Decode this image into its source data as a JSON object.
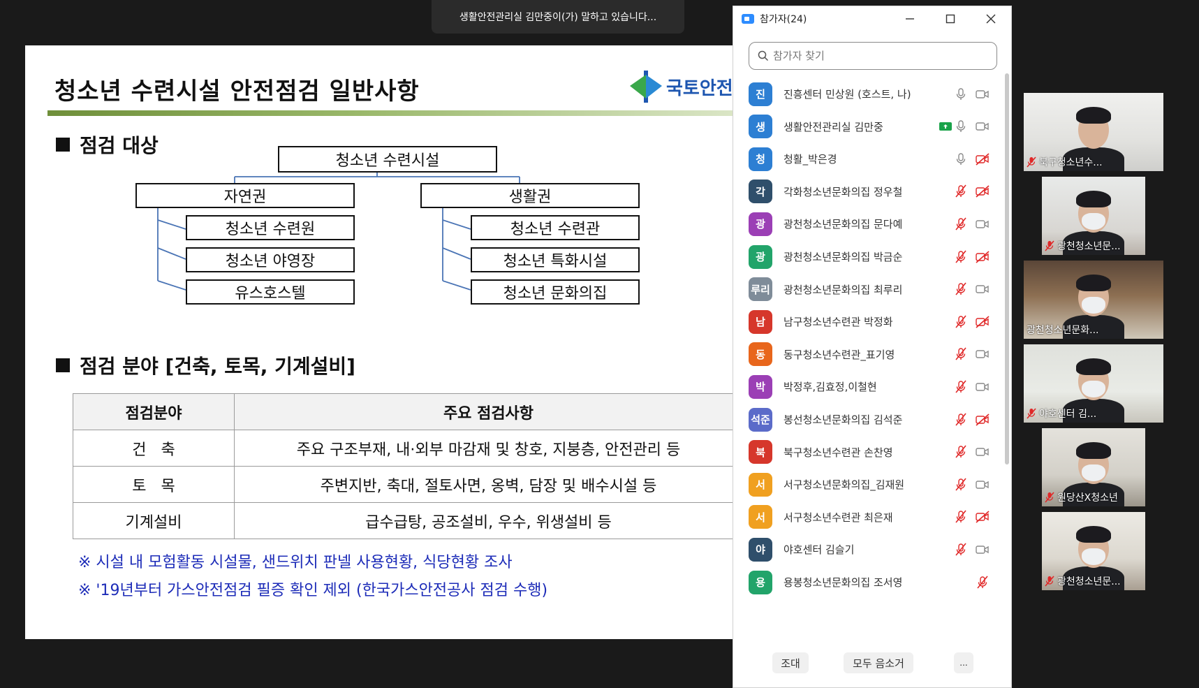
{
  "speaker_banner": "생활안전관리실 김만중이(가) 말하고 있습니다...",
  "slide": {
    "title": "청소년 수련시설 안전점검 일반사항",
    "logo_text": "국토안전",
    "section1": "점검 대상",
    "tree": {
      "root": "청소년 수련시설",
      "branches": [
        {
          "label": "자연권",
          "children": [
            "청소년 수련원",
            "청소년 야영장",
            "유스호스텔"
          ]
        },
        {
          "label": "생활권",
          "children": [
            "청소년 수련관",
            "청소년 특화시설",
            "청소년 문화의집"
          ]
        }
      ]
    },
    "section2": "점검 분야 [건축, 토목, 기계설비]",
    "table": {
      "headers": [
        "점검분야",
        "주요 점검사항"
      ],
      "rows": [
        [
          "건   축",
          "주요 구조부재, 내·외부 마감재 및 창호, 지붕층, 안전관리 등"
        ],
        [
          "토   목",
          "주변지반, 축대, 절토사면, 옹벽, 담장 및 배수시설 등"
        ],
        [
          "기계설비",
          "급수급탕, 공조설비, 우수, 위생설비 등"
        ]
      ]
    },
    "notes": [
      "※ 시설 내 모험활동 시설물, 샌드위치 판넬 사용현황, 식당현황 조사",
      "※ '19년부터 가스안전점검 필증 확인 제외 (한국가스안전공사 점검 수행)"
    ]
  },
  "panel": {
    "title": "참가자(24)",
    "search_placeholder": "참가자 찾기",
    "participants": [
      {
        "avatar": "진",
        "name": "진흥센터 민상원 (호스트, 나)",
        "color": "#2d7fd3",
        "mic": "on",
        "cam": "on",
        "share": false
      },
      {
        "avatar": "생",
        "name": "생활안전관리실 김만중",
        "color": "#2d7fd3",
        "mic": "on",
        "cam": "on",
        "share": true
      },
      {
        "avatar": "청",
        "name": "청활_박은경",
        "color": "#2d7fd3",
        "mic": "on",
        "cam": "off",
        "share": false
      },
      {
        "avatar": "각",
        "name": "각화청소년문화의집 정우철",
        "color": "#2f4f6b",
        "mic": "off",
        "cam": "off",
        "share": false
      },
      {
        "avatar": "광",
        "name": "광천청소년문화의집 문다예",
        "color": "#9b3fb5",
        "mic": "off",
        "cam": "on",
        "share": false
      },
      {
        "avatar": "광",
        "name": "광천청소년문화의집 박금순",
        "color": "#22a46a",
        "mic": "off",
        "cam": "off",
        "share": false
      },
      {
        "avatar": "루리",
        "name": "광천청소년문화의집 최루리",
        "color": "#7f8c99",
        "mic": "off",
        "cam": "on",
        "share": false
      },
      {
        "avatar": "남",
        "name": "남구청소년수련관 박정화",
        "color": "#d6372b",
        "mic": "off",
        "cam": "off",
        "share": false
      },
      {
        "avatar": "동",
        "name": "동구청소년수련관_표기영",
        "color": "#e8661c",
        "mic": "off",
        "cam": "on",
        "share": false
      },
      {
        "avatar": "박",
        "name": "박정후,김효정,이철현",
        "color": "#9b3fb5",
        "mic": "off",
        "cam": "on",
        "share": false
      },
      {
        "avatar": "석준",
        "name": "봉선청소년문화의집 김석준",
        "color": "#5b6bc9",
        "mic": "off",
        "cam": "off",
        "share": false
      },
      {
        "avatar": "북",
        "name": "북구청소년수련관 손찬영",
        "color": "#d6372b",
        "mic": "off",
        "cam": "on",
        "share": false
      },
      {
        "avatar": "서",
        "name": "서구청소년문화의집_김재원",
        "color": "#f0a020",
        "mic": "off",
        "cam": "on",
        "share": false
      },
      {
        "avatar": "서",
        "name": "서구청소년수련관 최은재",
        "color": "#f0a020",
        "mic": "off",
        "cam": "off",
        "share": false
      },
      {
        "avatar": "야",
        "name": "야호센터 김슬기",
        "color": "#2f4f6b",
        "mic": "off",
        "cam": "on",
        "share": false
      },
      {
        "avatar": "용",
        "name": "용봉청소년문화의집 조서영",
        "color": "#22a46a",
        "mic": "off",
        "cam": "none",
        "share": false
      }
    ],
    "footer": {
      "invite": "조대",
      "mute_all": "모두 음소거",
      "more": "..."
    }
  },
  "thumbnails": [
    {
      "label": "북구청소년수...",
      "muted": true
    },
    {
      "label": "광천청소년문...",
      "muted": true
    },
    {
      "label": "광천청소년문화...",
      "muted": false
    },
    {
      "label": "야호센터 김...",
      "muted": true
    },
    {
      "label": "원당산X청소년",
      "muted": true
    },
    {
      "label": "광천청소년문...",
      "muted": true
    }
  ],
  "colors": {
    "mute_red": "#e02828",
    "icon_gray": "#8a8a8a",
    "share_green": "#1aa34a",
    "note_blue": "#1d2cb8",
    "logo_blue": "#1e56b0"
  }
}
